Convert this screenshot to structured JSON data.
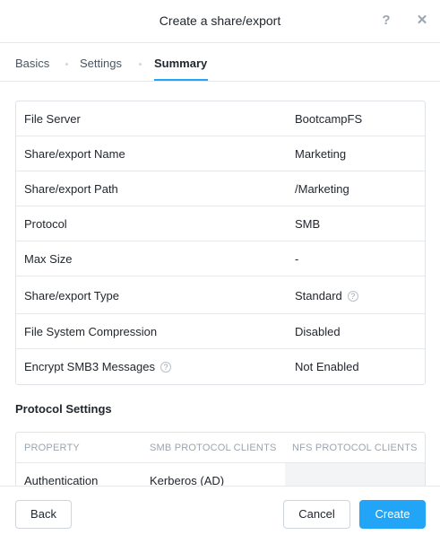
{
  "dialog": {
    "title": "Create a share/export",
    "help_icon": "?",
    "close_icon": "✕"
  },
  "tabs": [
    {
      "label": "Basics",
      "active": false
    },
    {
      "label": "Settings",
      "active": false
    },
    {
      "label": "Summary",
      "active": true
    }
  ],
  "summary": {
    "rows": [
      {
        "label": "File Server",
        "value": "BootcampFS"
      },
      {
        "label": "Share/export Name",
        "value": "Marketing"
      },
      {
        "label": "Share/export Path",
        "value": "/Marketing"
      },
      {
        "label": "Protocol",
        "value": "SMB"
      },
      {
        "label": "Max Size",
        "value": "-"
      },
      {
        "label": "Share/export Type",
        "value": "Standard"
      },
      {
        "label": "File System Compression",
        "value": "Disabled"
      },
      {
        "label": "Encrypt SMB3 Messages",
        "value": "Not Enabled"
      }
    ]
  },
  "protocol_settings": {
    "title": "Protocol Settings",
    "headers": [
      "PROPERTY",
      "SMB PROTOCOL CLIENTS",
      "NFS PROTOCOL CLIENTS"
    ],
    "rows": [
      {
        "property": "Authentication",
        "smb": "Kerberos (AD)",
        "nfs": ""
      }
    ]
  },
  "footer": {
    "back_label": "Back",
    "cancel_label": "Cancel",
    "create_label": "Create"
  },
  "colors": {
    "accent": "#22a5f7",
    "border": "#e0e4e8",
    "muted_text": "#9aa5b1"
  }
}
